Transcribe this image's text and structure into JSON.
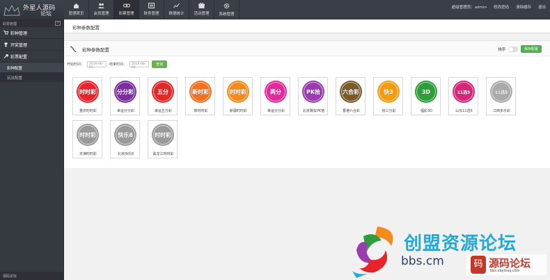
{
  "logo": {
    "line1": "外星人源码",
    "line2": "论坛"
  },
  "nav": [
    {
      "label": "管理首页",
      "icon": "home-icon"
    },
    {
      "label": "会员管理",
      "icon": "users-icon"
    },
    {
      "label": "彩票管理",
      "icon": "link-icon"
    },
    {
      "label": "财务管理",
      "icon": "finance-icon"
    },
    {
      "label": "数据统计",
      "icon": "chart-icon"
    },
    {
      "label": "活动管理",
      "icon": "gift-icon"
    },
    {
      "label": "系统管理",
      "icon": "gear-icon"
    }
  ],
  "topright": [
    "超级管理员：admin",
    "修改密码",
    "清除缓存",
    "退出"
  ],
  "sidebar": {
    "header": "彩票管理",
    "groups": [
      {
        "label": "彩种管理",
        "icon": "cart-icon"
      },
      {
        "label": "开奖管理",
        "icon": "trophy-icon"
      },
      {
        "label": "彩票配置",
        "icon": "wrench-icon"
      }
    ],
    "subs": [
      "彩种配置",
      "玩法配置"
    ],
    "footer": "源码论坛"
  },
  "breadcrumb": "彩种参数配置",
  "panel": {
    "title": "彩种参数配置",
    "sort_label": "排序",
    "save_label": "保存配置",
    "start_label": "开始时间：",
    "start_value": "2016-06-01",
    "end_label": "结束时间：",
    "end_value": "2016-06-01",
    "query_label": "查询"
  },
  "lotteries": [
    {
      "name": "重庆时时彩",
      "badge": "时时彩",
      "color": "#e8232a"
    },
    {
      "name": "幸运分分彩",
      "badge": "分分彩",
      "color": "#7b2f9e"
    },
    {
      "name": "幸运五分彩",
      "badge": "五分",
      "color": "#e02a2a"
    },
    {
      "name": "新时时彩",
      "badge": "新时彩",
      "color": "#f27121"
    },
    {
      "name": "新疆时时彩",
      "badge": "时时彩",
      "color": "#f28a1e"
    },
    {
      "name": "幸运分分彩",
      "badge": "两分",
      "color": "#e32a9c"
    },
    {
      "name": "北京赛车PK拾",
      "badge": "PK拾",
      "color": "#9b3bb0"
    },
    {
      "name": "香港六合彩",
      "badge": "六合彩",
      "color": "#7a5a2a"
    },
    {
      "name": "快三分彩",
      "badge": "快3",
      "color": "#f39c12"
    },
    {
      "name": "福彩3D",
      "badge": "3D",
      "color": "#2e9e3a"
    },
    {
      "name": "山东11选5",
      "badge": "11选5",
      "color": "#d5287a"
    },
    {
      "name": "江西多乐彩",
      "badge": "11选5",
      "color": "#aaaaaa"
    },
    {
      "name": "天津时时彩",
      "badge": "时时彩",
      "color": "#9a9a9a"
    },
    {
      "name": "北京快乐8",
      "badge": "快乐8",
      "color": "#9a9a9a"
    },
    {
      "name": "黑龙江时时彩",
      "badge": "时时彩",
      "color": "#9a9a9a"
    }
  ],
  "watermark": {
    "title": "创盟资源论坛",
    "url": "bbs.cm",
    "badge_text": "源码论坛",
    "badge_sub": "bbs.xbymsq.com"
  }
}
